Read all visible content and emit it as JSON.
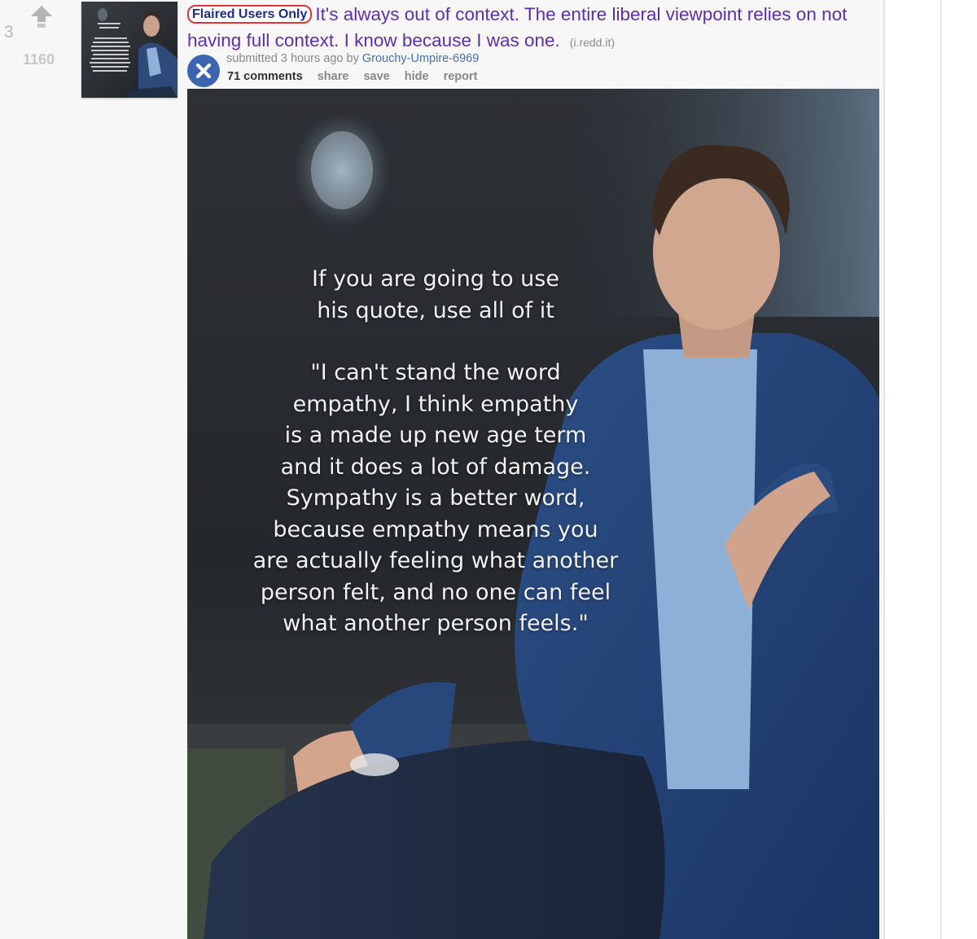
{
  "post": {
    "rank": "3",
    "score": "1160",
    "flair": "Flaired Users Only",
    "title": "It's always out of context. The entire liberal viewpoint relies on not having full context. I know because I was one.",
    "domain": "(i.redd.it)",
    "tagline": {
      "submitted": "submitted 3 hours ago by ",
      "author": "Grouchy-Umpire-6969"
    },
    "buttons": {
      "comments": "71 comments",
      "share": "share",
      "save": "save",
      "hide": "hide",
      "report": "report"
    }
  },
  "icons": {
    "vote": "upvote-arrow-icon",
    "expando": "close-icon"
  },
  "image": {
    "intro_line1": "If you are going to use",
    "intro_line2": "his quote, use all of it",
    "quote_lines": [
      "\"I can't stand the word",
      "empathy, I think empathy",
      "is a made up new age term",
      "and it does a lot of damage.",
      "Sympathy is a better word,",
      "because empathy means you",
      "are actually feeling what another",
      "person felt, and no one can feel",
      "what another person feels.\""
    ]
  },
  "colors": {
    "title": "#5d2fa8",
    "flair_text": "#1b2d8c",
    "flair_border": "#d9373b",
    "author": "#4a6ea8",
    "expando_button": "#3c65b1"
  }
}
